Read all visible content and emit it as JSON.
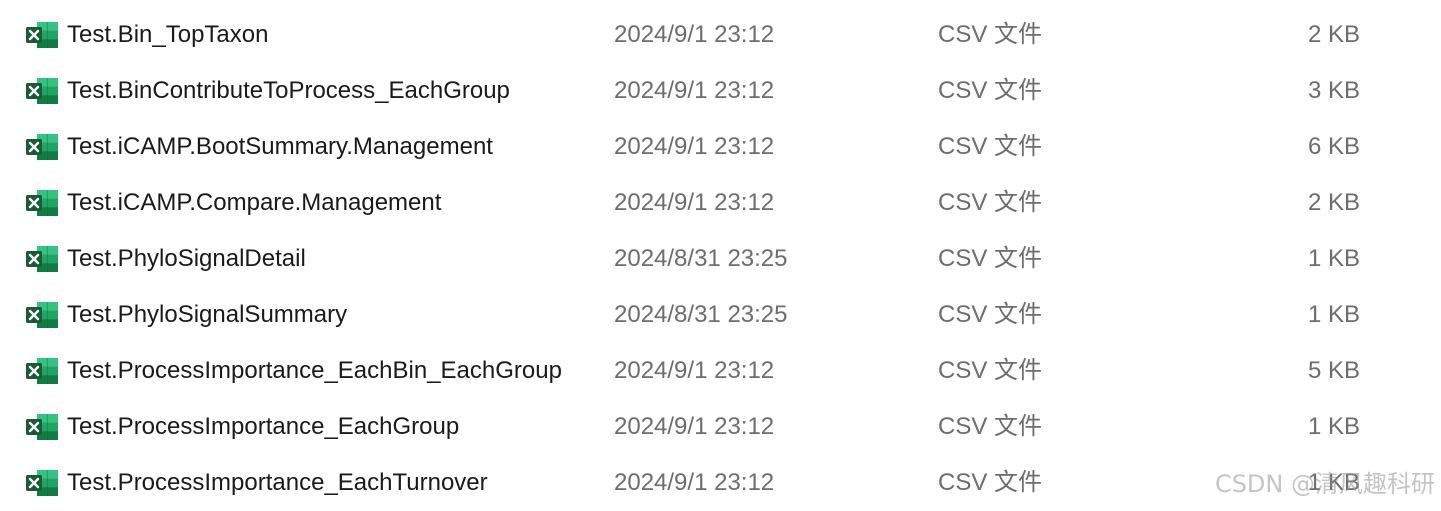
{
  "files": [
    {
      "name": "Test.Bin_TopTaxon",
      "date": "2024/9/1 23:12",
      "type": "CSV 文件",
      "size": "2 KB",
      "icon": "excel-csv-icon"
    },
    {
      "name": "Test.BinContributeToProcess_EachGroup",
      "date": "2024/9/1 23:12",
      "type": "CSV 文件",
      "size": "3 KB",
      "icon": "excel-csv-icon"
    },
    {
      "name": "Test.iCAMP.BootSummary.Management",
      "date": "2024/9/1 23:12",
      "type": "CSV 文件",
      "size": "6 KB",
      "icon": "excel-csv-icon"
    },
    {
      "name": "Test.iCAMP.Compare.Management",
      "date": "2024/9/1 23:12",
      "type": "CSV 文件",
      "size": "2 KB",
      "icon": "excel-csv-icon"
    },
    {
      "name": "Test.PhyloSignalDetail",
      "date": "2024/8/31 23:25",
      "type": "CSV 文件",
      "size": "1 KB",
      "icon": "excel-csv-icon"
    },
    {
      "name": "Test.PhyloSignalSummary",
      "date": "2024/8/31 23:25",
      "type": "CSV 文件",
      "size": "1 KB",
      "icon": "excel-csv-icon"
    },
    {
      "name": "Test.ProcessImportance_EachBin_EachGroup",
      "date": "2024/9/1 23:12",
      "type": "CSV 文件",
      "size": "5 KB",
      "icon": "excel-csv-icon"
    },
    {
      "name": "Test.ProcessImportance_EachGroup",
      "date": "2024/9/1 23:12",
      "type": "CSV 文件",
      "size": "1 KB",
      "icon": "excel-csv-icon"
    },
    {
      "name": "Test.ProcessImportance_EachTurnover",
      "date": "2024/9/1 23:12",
      "type": "CSV 文件",
      "size": "1 KB",
      "icon": "excel-csv-icon"
    }
  ],
  "watermark": "CSDN @清风趣科研",
  "colors": {
    "icon_dark_green": "#1e6e3e",
    "icon_light_green": "#21a366",
    "icon_mid_green": "#107c41",
    "secondary_text": "#6d6d6d",
    "primary_text": "#1a1a1a"
  }
}
